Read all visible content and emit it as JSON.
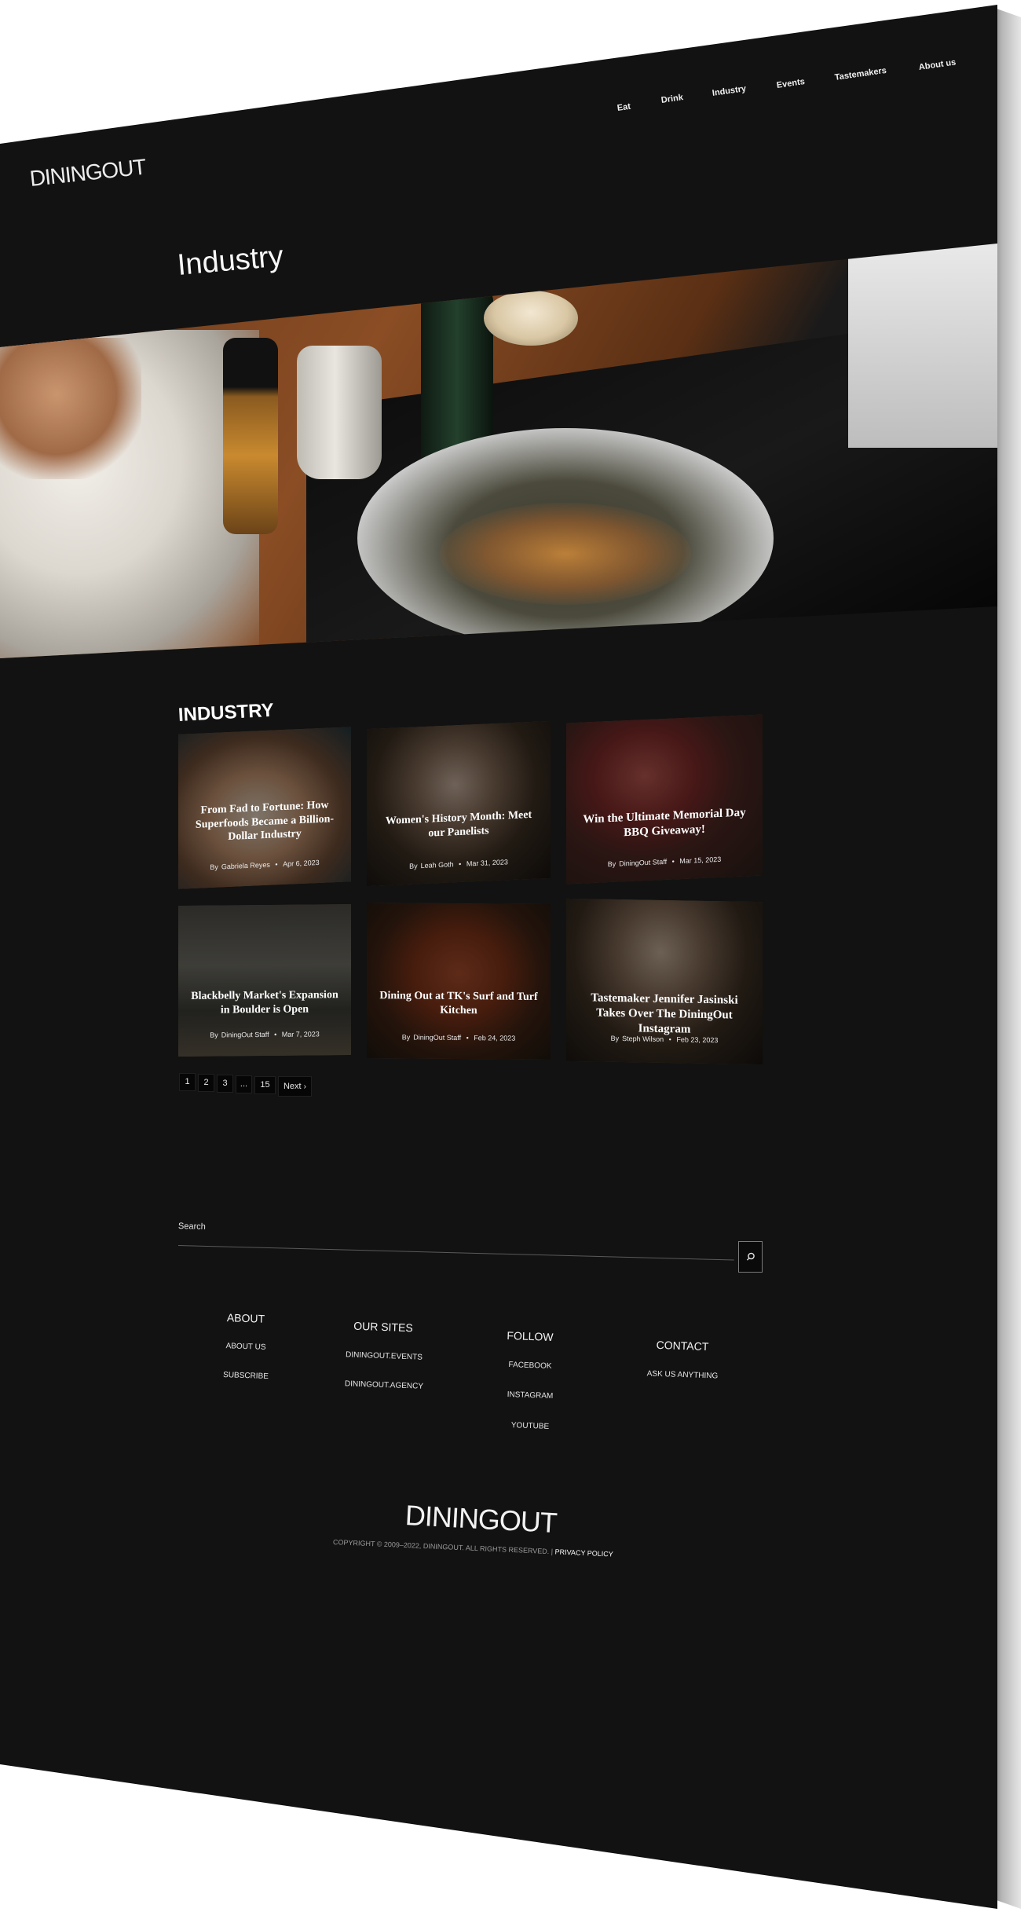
{
  "site": {
    "logo": "DININGOUT"
  },
  "nav": {
    "items": [
      {
        "label": "Eat"
      },
      {
        "label": "Drink"
      },
      {
        "label": "Industry"
      },
      {
        "label": "Events"
      },
      {
        "label": "Tastemakers"
      },
      {
        "label": "About us"
      }
    ]
  },
  "header": {
    "title": "Industry"
  },
  "section": {
    "title": "INDUSTRY"
  },
  "articles": [
    {
      "title": "From Fad to Fortune: How Superfoods Became a Billion-Dollar Industry",
      "by": "By",
      "author": "Gabriela Reyes",
      "sep": "•",
      "date": "Apr 6, 2023"
    },
    {
      "title": "Women's History Month: Meet our Panelists",
      "by": "By",
      "author": "Leah Goth",
      "sep": "•",
      "date": "Mar 31, 2023"
    },
    {
      "title": "Win the Ultimate Memorial Day BBQ Giveaway!",
      "by": "By",
      "author": "DiningOut Staff",
      "sep": "•",
      "date": "Mar 15, 2023"
    },
    {
      "title": "Blackbelly Market's Expansion in Boulder is Open",
      "by": "By",
      "author": "DiningOut Staff",
      "sep": "•",
      "date": "Mar 7, 2023"
    },
    {
      "title": "Dining Out at TK's Surf and Turf Kitchen",
      "by": "By",
      "author": "DiningOut Staff",
      "sep": "•",
      "date": "Feb 24, 2023"
    },
    {
      "title": "Tastemaker Jennifer Jasinski Takes Over The DiningOut Instagram",
      "by": "By",
      "author": "Steph Wilson",
      "sep": "•",
      "date": "Feb 23, 2023"
    }
  ],
  "pagination": {
    "pages": [
      "1",
      "2",
      "3",
      "...",
      "15"
    ],
    "next": "Next",
    "next_icon": "chevron-right-icon"
  },
  "search": {
    "label": "Search",
    "placeholder": "",
    "icon": "search-icon"
  },
  "footer": {
    "about": {
      "heading": "ABOUT",
      "links": [
        "ABOUT US",
        "SUBSCRIBE"
      ]
    },
    "sites": {
      "heading": "OUR SITES",
      "links": [
        "DININGOUT.EVENTS",
        "DININGOUT.AGENCY"
      ]
    },
    "follow": {
      "heading": "FOLLOW",
      "links": [
        "FACEBOOK",
        "INSTAGRAM",
        "YOUTUBE"
      ]
    },
    "contact": {
      "heading": "CONTACT",
      "links": [
        "ASK US ANYTHING"
      ]
    },
    "logo": "DININGOUT",
    "copyright": "COPYRIGHT © 2009–2022, DININGOUT. ALL RIGHTS RESERVED. |",
    "privacy": "PRIVACY POLICY"
  },
  "colors": {
    "background": "#121212",
    "text": "#ffffff",
    "button": "#060606"
  }
}
